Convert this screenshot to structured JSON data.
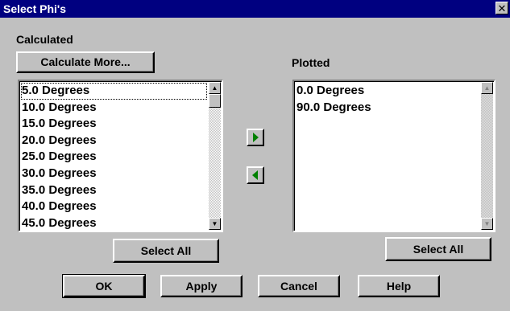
{
  "window": {
    "title": "Select Phi's",
    "close_glyph": "✕"
  },
  "calculated": {
    "label": "Calculated",
    "calc_more_label": "Calculate More...",
    "items": [
      "5.0 Degrees",
      "10.0 Degrees",
      "15.0 Degrees",
      "20.0 Degrees",
      "25.0 Degrees",
      "30.0 Degrees",
      "35.0 Degrees",
      "40.0 Degrees",
      "45.0 Degrees"
    ],
    "select_all_label": "Select All"
  },
  "plotted": {
    "label": "Plotted",
    "items": [
      "0.0 Degrees",
      "90.0 Degrees"
    ],
    "select_all_label": "Select All"
  },
  "transfer": {
    "add_icon": "arrow-right-icon",
    "remove_icon": "arrow-left-icon",
    "arrow_color": "#008000"
  },
  "footer": {
    "ok_label": "OK",
    "apply_label": "Apply",
    "cancel_label": "Cancel",
    "help_label": "Help"
  }
}
